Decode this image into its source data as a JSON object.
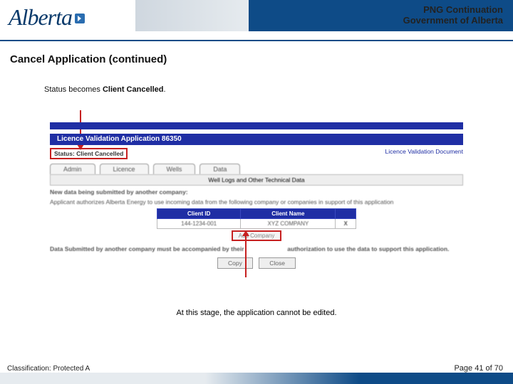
{
  "header": {
    "logo_text": "Alberta",
    "title_line1": "PNG Continuation",
    "title_line2": "Government of Alberta"
  },
  "section_title": "Cancel Application (continued)",
  "body": {
    "status_prefix": "Status becomes ",
    "status_bold": "Client Cancelled",
    "status_suffix": "."
  },
  "shot": {
    "panel_title": "Licence Validation Application 86350",
    "status_label": "Status: Client Cancelled",
    "doc_link": "Licence Validation Document",
    "tabs": [
      "Admin",
      "Licence",
      "Wells",
      "Data"
    ],
    "sub_header": "Well Logs and Other Technical Data",
    "blur_line1": "New data being submitted by another company:",
    "blur_line2": "Applicant authorizes Alberta Energy to use incoming data from the following company or companies in support of this application",
    "table": {
      "headers": [
        "Client ID",
        "Client Name"
      ],
      "rows": [
        {
          "id": "144-1234-001",
          "name": "XYZ COMPANY",
          "x": "X"
        }
      ]
    },
    "add_company": "Add Company",
    "blur_line3a": "Data Submitted by another company must be accompanied by their",
    "blur_line3b": "authorization to use the data to support this application.",
    "buttons": [
      "Copy",
      "Close"
    ]
  },
  "caption": "At this stage, the application cannot be edited.",
  "footer": {
    "classification": "Classification: Protected A",
    "page_prefix": "Page ",
    "page_current": "41",
    "page_mid": " of ",
    "page_total": "70"
  }
}
